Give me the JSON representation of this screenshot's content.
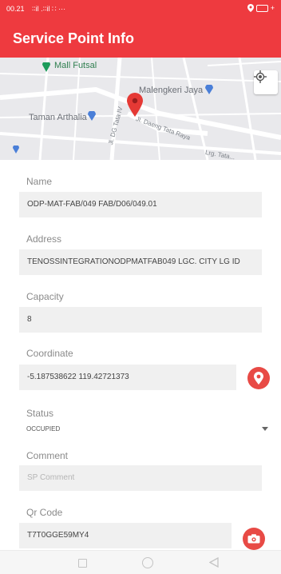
{
  "status_bar": {
    "time": "00.21",
    "signal_text": "∶∶il .∶∶il ∷ ···",
    "battery_icon": "battery-icon"
  },
  "app_bar": {
    "title": "Service Point Info"
  },
  "map": {
    "labels": {
      "mall": "Mall Futsal",
      "malengkeri": "Malengkeri Jaya",
      "taman": "Taman Arthalia",
      "road_daeng": "Jl. Daeng Tata Raya",
      "road_dg": "Jl. DG Tata IV",
      "road_small": "Lrg. Tata..."
    },
    "accent_pin": "#e53935"
  },
  "form": {
    "name": {
      "label": "Name",
      "value": "ODP-MAT-FAB/049 FAB/D06/049.01"
    },
    "address": {
      "label": "Address",
      "value": "TENOSSINTEGRATIONODPMATFAB049 LGC. CITY LG ID"
    },
    "capacity": {
      "label": "Capacity",
      "value": "8"
    },
    "coordinate": {
      "label": "Coordinate",
      "value": "-5.187538622 119.42721373"
    },
    "status": {
      "label": "Status",
      "value": "OCCUPIED"
    },
    "comment": {
      "label": "Comment",
      "placeholder": "SP Comment"
    },
    "qr_code": {
      "label": "Qr Code",
      "value": "T7T0GGE59MY4"
    }
  },
  "colors": {
    "primary": "#ee3a3f",
    "action_button": "#e84a45",
    "field_bg": "#f0f0f0"
  }
}
